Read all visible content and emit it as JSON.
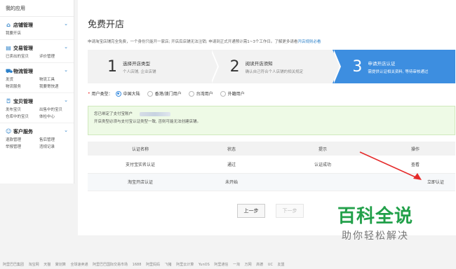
{
  "sidebar": {
    "header": "我的应用",
    "groups": [
      {
        "title": "店铺管理",
        "links": [
          "我要开店"
        ]
      },
      {
        "title": "交易管理",
        "links": [
          "已卖出的宝贝",
          "评价管理"
        ]
      },
      {
        "title": "物流管理",
        "links": [
          "发货",
          "物流工具",
          "物流服务",
          "我要寄快递"
        ]
      },
      {
        "title": "宝贝管理",
        "links": [
          "发布宝贝",
          "出售中的宝贝",
          "仓库中的宝贝",
          "体检中心"
        ]
      },
      {
        "title": "客户服务",
        "links": [
          "退款管理",
          "售后管理",
          "举报管理",
          "违规记录"
        ]
      }
    ]
  },
  "main": {
    "title": "免费开店",
    "notice": "申请淘宝店铺完全免费，一个身份只能开一家店; 开店后店铺无法注销; 申请到正式开通预计需1~3个工作日。了解更多请看",
    "notice_link": "开店规则必看",
    "steps": [
      {
        "num": "1",
        "title": "选择开店类型",
        "desc": "个人店铺, 企业店铺"
      },
      {
        "num": "2",
        "title": "阅读开店须知",
        "desc": "确认自己符合个人店铺的相关规定"
      },
      {
        "num": "3",
        "title": "申请开店认证",
        "desc": "需提供认证相关资料, 等待审核通过"
      }
    ],
    "user_type_label": "用户类型：",
    "user_types": [
      "中国大陆",
      "香港/澳门用户",
      "台湾用户",
      "外籍用户"
    ],
    "alert_line1": "您已绑定了支付宝账户",
    "alert_line2": "开店类型必须与支付宝认证类型一致, 否则可能无法创建店铺。",
    "table": {
      "headers": [
        "认证名称",
        "状态",
        "提示",
        "操作"
      ],
      "rows": [
        {
          "name": "支付宝实名认证",
          "status": "通过",
          "hint": "认证成功",
          "action": "查看"
        },
        {
          "name": "淘宝开店认证",
          "status": "未开始",
          "hint": "",
          "action": "立即认证"
        }
      ]
    },
    "prev_label": "上一步",
    "next_label": "下一步"
  },
  "watermark": {
    "big": "百科全说",
    "small": "助你轻松解决"
  },
  "footer": [
    "阿里巴巴集团",
    "淘宝网",
    "天猫",
    "聚划算",
    "全球速卖通",
    "阿里巴巴国际交易市场",
    "1688",
    "阿里妈妈",
    "飞猪",
    "阿里云计算",
    "YunOS",
    "阿里通信",
    "一淘",
    "万网",
    "高德",
    "UC",
    "友盟"
  ],
  "colors": {
    "accent": "#3d8ee0",
    "success": "#3cae3c",
    "link": "#2b80c9",
    "watermark": "#22a04a"
  }
}
